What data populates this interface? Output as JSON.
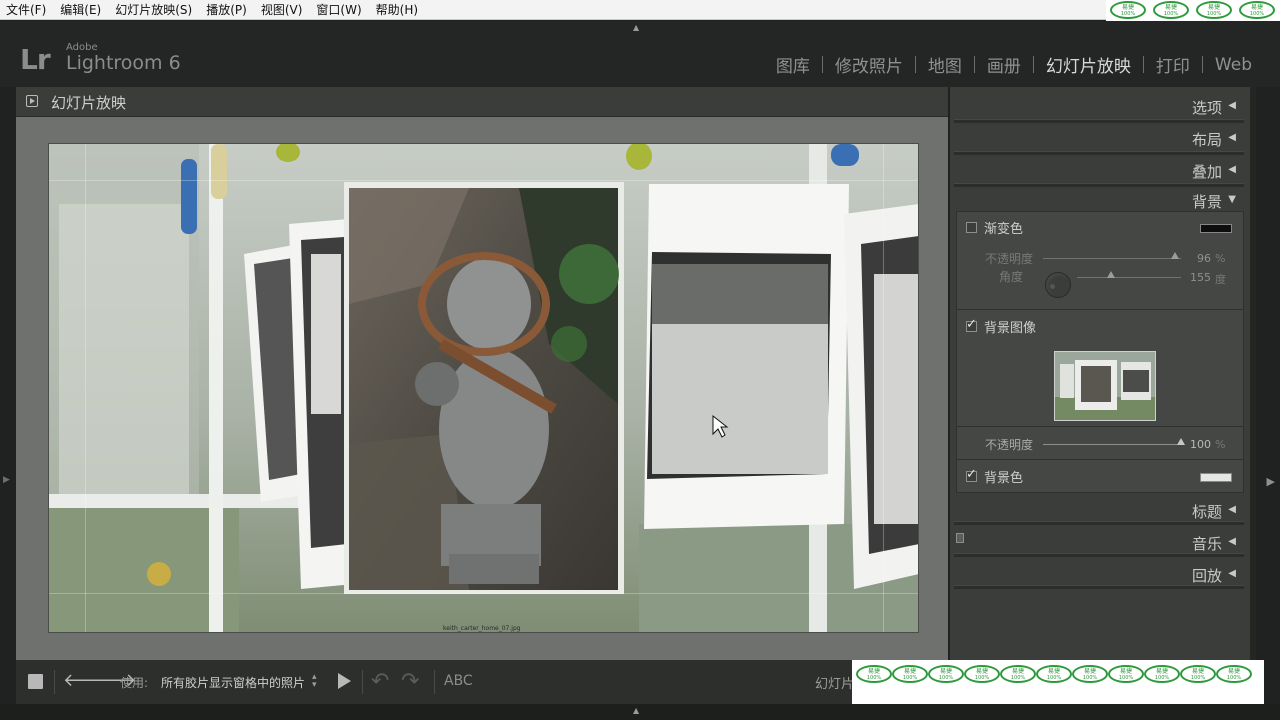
{
  "menubar": {
    "items": [
      "文件(F)",
      "编辑(E)",
      "幻灯片放映(S)",
      "播放(P)",
      "视图(V)",
      "窗口(W)",
      "帮助(H)"
    ]
  },
  "identity": {
    "logo": "Lr",
    "vendor": "Adobe",
    "product": "Lightroom 6",
    "modules": [
      {
        "label": "图库",
        "active": false
      },
      {
        "label": "修改照片",
        "active": false
      },
      {
        "label": "地图",
        "active": false
      },
      {
        "label": "画册",
        "active": false
      },
      {
        "label": "幻灯片放映",
        "active": true
      },
      {
        "label": "打印",
        "active": false
      },
      {
        "label": "Web",
        "active": false
      }
    ]
  },
  "center": {
    "title": "幻灯片放映",
    "caption": "keith_carter_home_07.jpg"
  },
  "panel": {
    "sections": {
      "options": "选项",
      "layout": "布局",
      "overlays": "叠加",
      "backdrop": "背景",
      "titles": "标题",
      "music": "音乐",
      "playback": "回放"
    },
    "backdrop": {
      "color_wash": {
        "label": "渐变色",
        "checked": false,
        "color": "#0d0d0d"
      },
      "opacity": {
        "label": "不透明度",
        "value": "96",
        "unit": "%",
        "level": 0.96
      },
      "angle": {
        "label": "角度",
        "value": "155",
        "unit": "度",
        "level": 0.33
      },
      "bg_image": {
        "label": "背景图像",
        "checked": true
      },
      "bg_image_opacity": {
        "label": "不透明度",
        "value": "100",
        "unit": "%",
        "level": 1.0
      },
      "bg_color": {
        "label": "背景色",
        "checked": true,
        "color": "#e6e6e6"
      }
    }
  },
  "toolbar": {
    "use_label": "使用:",
    "use_value": "所有胶片显示窗格中的照片",
    "abc": "ABC",
    "slide_label": "幻灯片"
  },
  "badges": {
    "top_text": "易捷",
    "bottom_text": "100%"
  }
}
